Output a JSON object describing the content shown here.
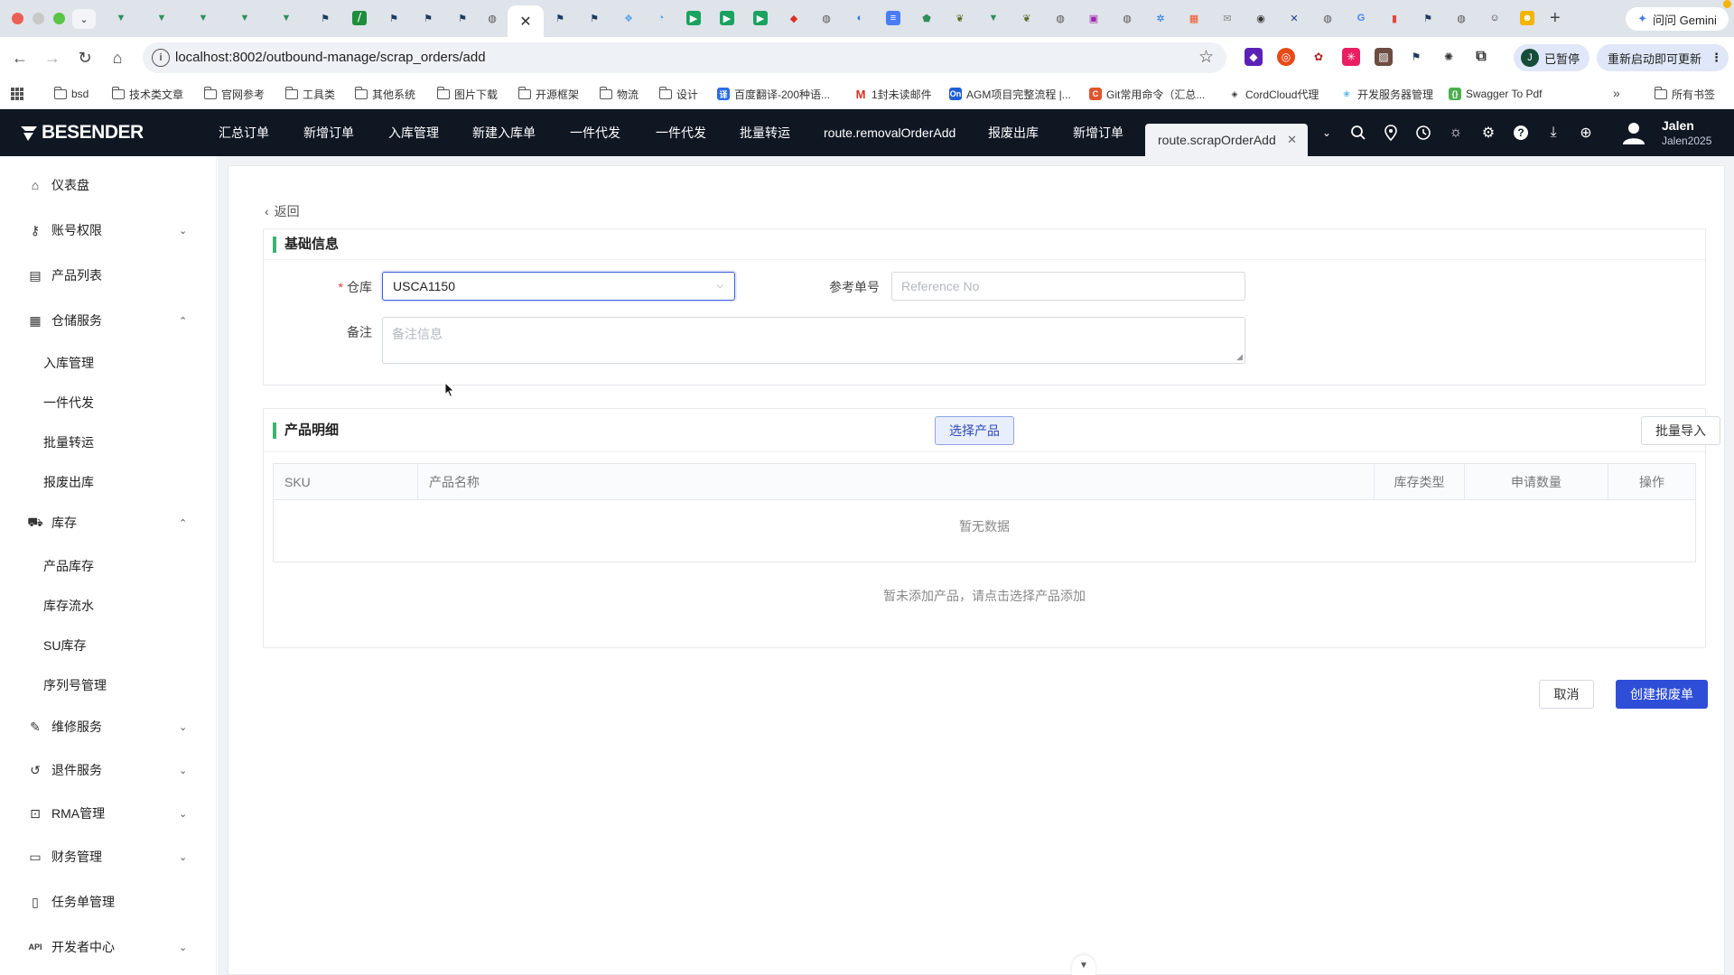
{
  "browser": {
    "active_tab_close": "✕",
    "new_tab": "+",
    "gemini_label": "问问 Gemini",
    "url": "localhost:8002/outbound-manage/scrap_orders/add",
    "paused_label": "已暂停",
    "paused_avatar": "J",
    "restart_label": "重新启动即可更新",
    "bookmarks": [
      {
        "label": "bsd",
        "kind": "folder"
      },
      {
        "label": "技术类文章",
        "kind": "folder"
      },
      {
        "label": "官网参考",
        "kind": "folder"
      },
      {
        "label": "工具类",
        "kind": "folder"
      },
      {
        "label": "其他系统",
        "kind": "folder"
      },
      {
        "label": "图片下载",
        "kind": "folder"
      },
      {
        "label": "开源框架",
        "kind": "folder"
      },
      {
        "label": "物流",
        "kind": "folder"
      },
      {
        "label": "设计",
        "kind": "folder"
      },
      {
        "label": "百度翻译-200种语...",
        "kind": "site",
        "color": "#2b6de5",
        "glyph": "译"
      },
      {
        "label": "1封未读邮件",
        "kind": "site",
        "color": "#d93025",
        "glyph": "M"
      },
      {
        "label": "AGM项目完整流程 |...",
        "kind": "site",
        "color": "#1d5fd6",
        "glyph": "On"
      },
      {
        "label": "Git常用命令（汇总...",
        "kind": "site",
        "color": "#e0552e",
        "glyph": "C"
      },
      {
        "label": "CordCloud代理",
        "kind": "site",
        "color": "#333333",
        "glyph": "◈"
      },
      {
        "label": "开发服务器管理",
        "kind": "site",
        "color": "#4fb3e8",
        "glyph": "❀"
      },
      {
        "label": "Swagger To Pdf",
        "kind": "site",
        "color": "#4caf50",
        "glyph": "{}"
      }
    ],
    "bookmarks_more": "»",
    "all_bookmarks": "所有书签"
  },
  "app": {
    "brand": "BESENDER",
    "nav": [
      "汇总订单",
      "新增订单",
      "入库管理",
      "新建入库单",
      "一件代发",
      "一件代发",
      "批量转运",
      "route.removalOrderAdd",
      "报废出库",
      "新增订单"
    ],
    "active_tab": "route.scrapOrderAdd",
    "active_tab_close": "✕",
    "user_name": "Jalen",
    "user_id": "Jalen2025"
  },
  "sidebar": {
    "items": [
      {
        "label": "仪表盘",
        "icon": "home-icon"
      },
      {
        "label": "账号权限",
        "icon": "key-icon",
        "expanded": false
      },
      {
        "label": "产品列表",
        "icon": "list-icon"
      },
      {
        "label": "仓储服务",
        "icon": "warehouse-icon",
        "expanded": true
      },
      {
        "label": "库存",
        "icon": "truck-icon",
        "expanded": true
      },
      {
        "label": "维修服务",
        "icon": "wrench-icon",
        "expanded": false
      },
      {
        "label": "退件服务",
        "icon": "return-icon",
        "expanded": false
      },
      {
        "label": "RMA管理",
        "icon": "lock-icon",
        "expanded": false
      },
      {
        "label": "财务管理",
        "icon": "wallet-icon",
        "expanded": false
      },
      {
        "label": "任务单管理",
        "icon": "clipboard-icon"
      },
      {
        "label": "开发者中心",
        "icon": "api-icon",
        "expanded": false
      }
    ],
    "warehouse_sub": [
      "入库管理",
      "一件代发",
      "批量转运",
      "报废出库"
    ],
    "inventory_sub": [
      "产品库存",
      "库存流水",
      "SU库存",
      "序列号管理"
    ],
    "api_tag": "API"
  },
  "page": {
    "back_label": "返回",
    "basic_info_title": "基础信息",
    "warehouse_label": "仓库",
    "warehouse_value": "USCA1150",
    "reference_label": "参考单号",
    "reference_placeholder": "Reference No",
    "remark_label": "备注",
    "remark_placeholder": "备注信息",
    "product_detail_title": "产品明细",
    "select_product_button": "选择产品",
    "batch_import_button": "批量导入",
    "table_headers": [
      "SKU",
      "产品名称",
      "库存类型",
      "申请数量",
      "操作"
    ],
    "table_empty": "暂无数据",
    "empty_tip": "暂未添加产品，请点击选择产品添加",
    "cancel_button": "取消",
    "create_button": "创建报废单"
  },
  "colors": {
    "brand_dark": "#0f1723",
    "primary": "#2f4ed8",
    "section_accent": "#3cb371"
  }
}
